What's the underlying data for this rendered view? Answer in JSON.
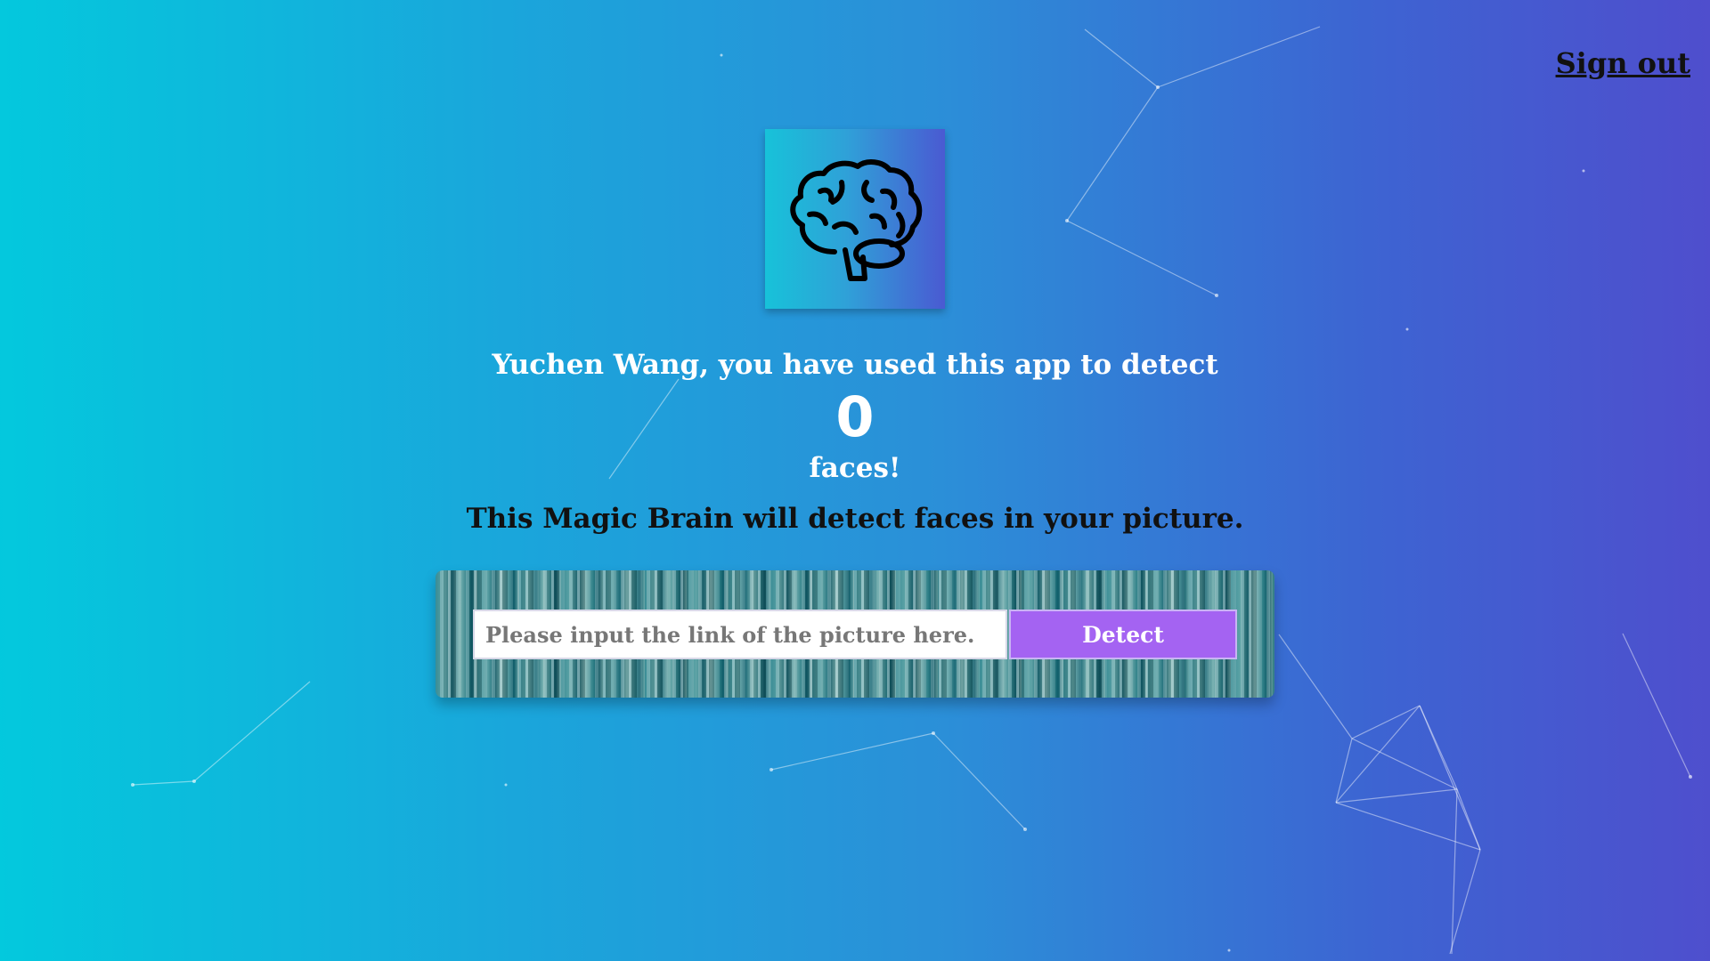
{
  "navigation": {
    "sign_out_label": "Sign out"
  },
  "logo": {
    "icon": "brain-icon"
  },
  "rank": {
    "line": "Yuchen Wang, you have used this app to detect",
    "count": "0",
    "suffix": "faces!"
  },
  "intro_text": "This Magic Brain will detect faces in your picture.",
  "image_link_form": {
    "placeholder": "Please input the link of the picture here.",
    "value": "",
    "detect_label": "Detect"
  },
  "colors": {
    "gradient_start": "#03c9dd",
    "gradient_end": "#4f4ecd",
    "detect_button": "#a463f2"
  }
}
